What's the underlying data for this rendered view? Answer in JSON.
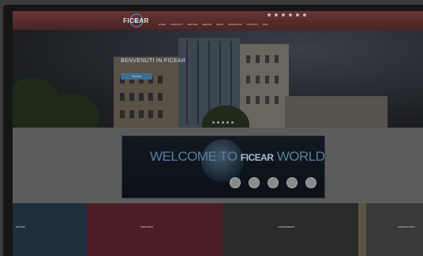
{
  "site": {
    "logo_text": "FICEAR"
  },
  "nav": {
    "social_icons": [
      "facebook-icon",
      "twitter-icon",
      "linkedin-icon",
      "youtube-icon",
      "instagram-icon",
      "mail-icon"
    ],
    "menu": [
      "HOME",
      "PRODOTTI",
      "SETTORI",
      "SERVIZI",
      "NEWS",
      "DOWNLOAD",
      "CONTATTI",
      "ENG"
    ]
  },
  "hero": {
    "title": "BENVENUTI IN FICEAR",
    "button_label": "SCOPRI",
    "slides": 5
  },
  "banner": {
    "text_left": "WELCOME TO",
    "text_logo": "FICEAR",
    "text_right": "WORLD",
    "icons": [
      "gear-icon",
      "car-icon",
      "factory-icon",
      "truck-icon",
      "tools-icon"
    ]
  },
  "tiles": [
    {
      "label": "EDILIZIA",
      "color": "#1e2f3e"
    },
    {
      "label": "INDUSTRIA",
      "color": "#4a1e22"
    },
    {
      "label": "CARROZZERIA",
      "color": "#2a2a2a"
    },
    {
      "label": "",
      "color": "#5a5346"
    },
    {
      "label": "AGRICOLTURA",
      "color": "#3a3a3a"
    }
  ]
}
